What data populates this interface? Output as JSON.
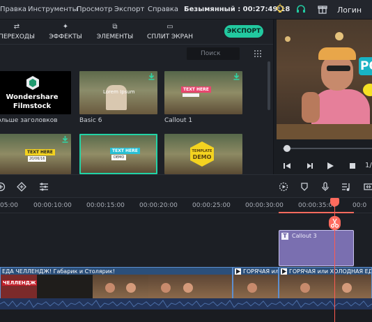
{
  "menu": {
    "items": [
      "Правка",
      "Инструменты",
      "Просмотр",
      "Экспорт",
      "Справка"
    ],
    "project_title": "Безымянный : 00:27:49:18",
    "login": "Логин",
    "icons": [
      "bulb-icon",
      "headset-icon",
      "gift-icon"
    ]
  },
  "tabs": [
    {
      "label": "ПЕРЕХОДЫ",
      "icon": "transitions-icon"
    },
    {
      "label": "ЭФФЕКТЫ",
      "icon": "effects-icon"
    },
    {
      "label": "ЭЛЕМЕНТЫ",
      "icon": "elements-icon"
    },
    {
      "label": "СПЛИТ ЭКРАН",
      "icon": "split-screen-icon"
    }
  ],
  "export_label": "ЭКСПОРТ",
  "search": {
    "placeholder": "Поиск"
  },
  "library": {
    "filmstock": {
      "line1": "Wondershare",
      "line2": "Filmstock",
      "caption": "ольше заголовков"
    },
    "cards": [
      {
        "caption": "Basic 6",
        "overlay": "Lorem Ipsum"
      },
      {
        "caption": "Callout 1",
        "overlay": "TEXT HERE"
      }
    ],
    "row2": [
      {
        "overlay1": "TEXT HERE",
        "overlay2": "20/06/16"
      },
      {
        "overlay1": "TEXT HERE",
        "overlay2": "DEMO"
      },
      {
        "overlay1": "TEMPLATE",
        "overlay2": "DEMO"
      }
    ]
  },
  "preview": {
    "video_overlay": "PO",
    "time_fragment": "1/"
  },
  "ruler": {
    "ticks": [
      "05:00",
      "00:00:10:00",
      "00:00:15:00",
      "00:00:20:00",
      "00:00:25:00",
      "00:00:30:00",
      "00:00:35:00",
      "00:0"
    ]
  },
  "timeline": {
    "callout_clip": {
      "label": "Callout 3",
      "type_letter": "T"
    },
    "video_clips": [
      {
        "title": "ЕДА ЧЕЛЛЕНДЖ! Габарик и Столярик!"
      },
      {
        "title": "ГОРЯЧАЯ или"
      },
      {
        "title": "ГОРЯЧАЯ или ХОЛОДНАЯ ЕДА Ч"
      }
    ],
    "thumb_overlay": "ЧЕЛЛЕНДЖ"
  },
  "colors": {
    "accent": "#22c9a0",
    "playhead": "#ff5a4f",
    "callout": "#7a6fb0",
    "video_clip": "#2b4f7a"
  }
}
